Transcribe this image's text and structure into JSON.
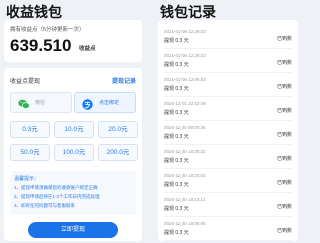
{
  "left": {
    "title": "收益钱包",
    "balance": {
      "label": "拥有收益点（5分钟更新一次）",
      "value": "639.510",
      "unit": "收益点"
    },
    "withdraw": {
      "label": "收益点提现",
      "record_link": "提现记录",
      "methods": [
        {
          "label": "微信",
          "icon": "wechat-icon",
          "selected": false
        },
        {
          "label": "点击绑定",
          "icon": "alipay-icon",
          "selected": true
        }
      ],
      "amounts": [
        "0.3元",
        "10.0元",
        "20.0元",
        "50.0元",
        "100.0元",
        "200.0元"
      ],
      "notice_title": "温馨提示：",
      "notice_lines": [
        "1、提现申请须确保您的收款账户绑定正确",
        "2、提现申请后将在1-3个工作日内完成处理",
        "3、如有任何问题可与客服联系"
      ],
      "submit_label": "立即提现"
    }
  },
  "right": {
    "title": "钱包记录",
    "records": [
      {
        "date": "2021-01-06 12:26:32",
        "amount": "提现 0.3 元",
        "status": "已到账"
      },
      {
        "date": "2021-01-06 12:26:32",
        "amount": "提现 0.3 元",
        "status": "已到账"
      },
      {
        "date": "2021-01-06 12:06:53",
        "amount": "提现 0.3 元",
        "status": "已到账"
      },
      {
        "date": "2020-12-01 22:52:49",
        "amount": "提现 0.3 元",
        "status": "已到账"
      },
      {
        "date": "2020-11-30 09:00:36",
        "amount": "提现 0.3 元",
        "status": "已到账"
      },
      {
        "date": "2020-11-30 18:30:32",
        "amount": "提现 0.3 元",
        "status": "已到账"
      },
      {
        "date": "2020-11-30 18:20:02",
        "amount": "提现 0.3 元",
        "status": "已到账"
      },
      {
        "date": "2020-11-30 18:13:12",
        "amount": "提现 0.3 元",
        "status": "已到账"
      },
      {
        "date": "2020-11-30 18:06:05",
        "amount": "提现 0.3 元",
        "status": "已到账"
      }
    ]
  },
  "colors": {
    "accent": "#1a73e8",
    "link": "#2a7de1",
    "wechat": "#2fb453",
    "alipay": "#1677ff"
  }
}
